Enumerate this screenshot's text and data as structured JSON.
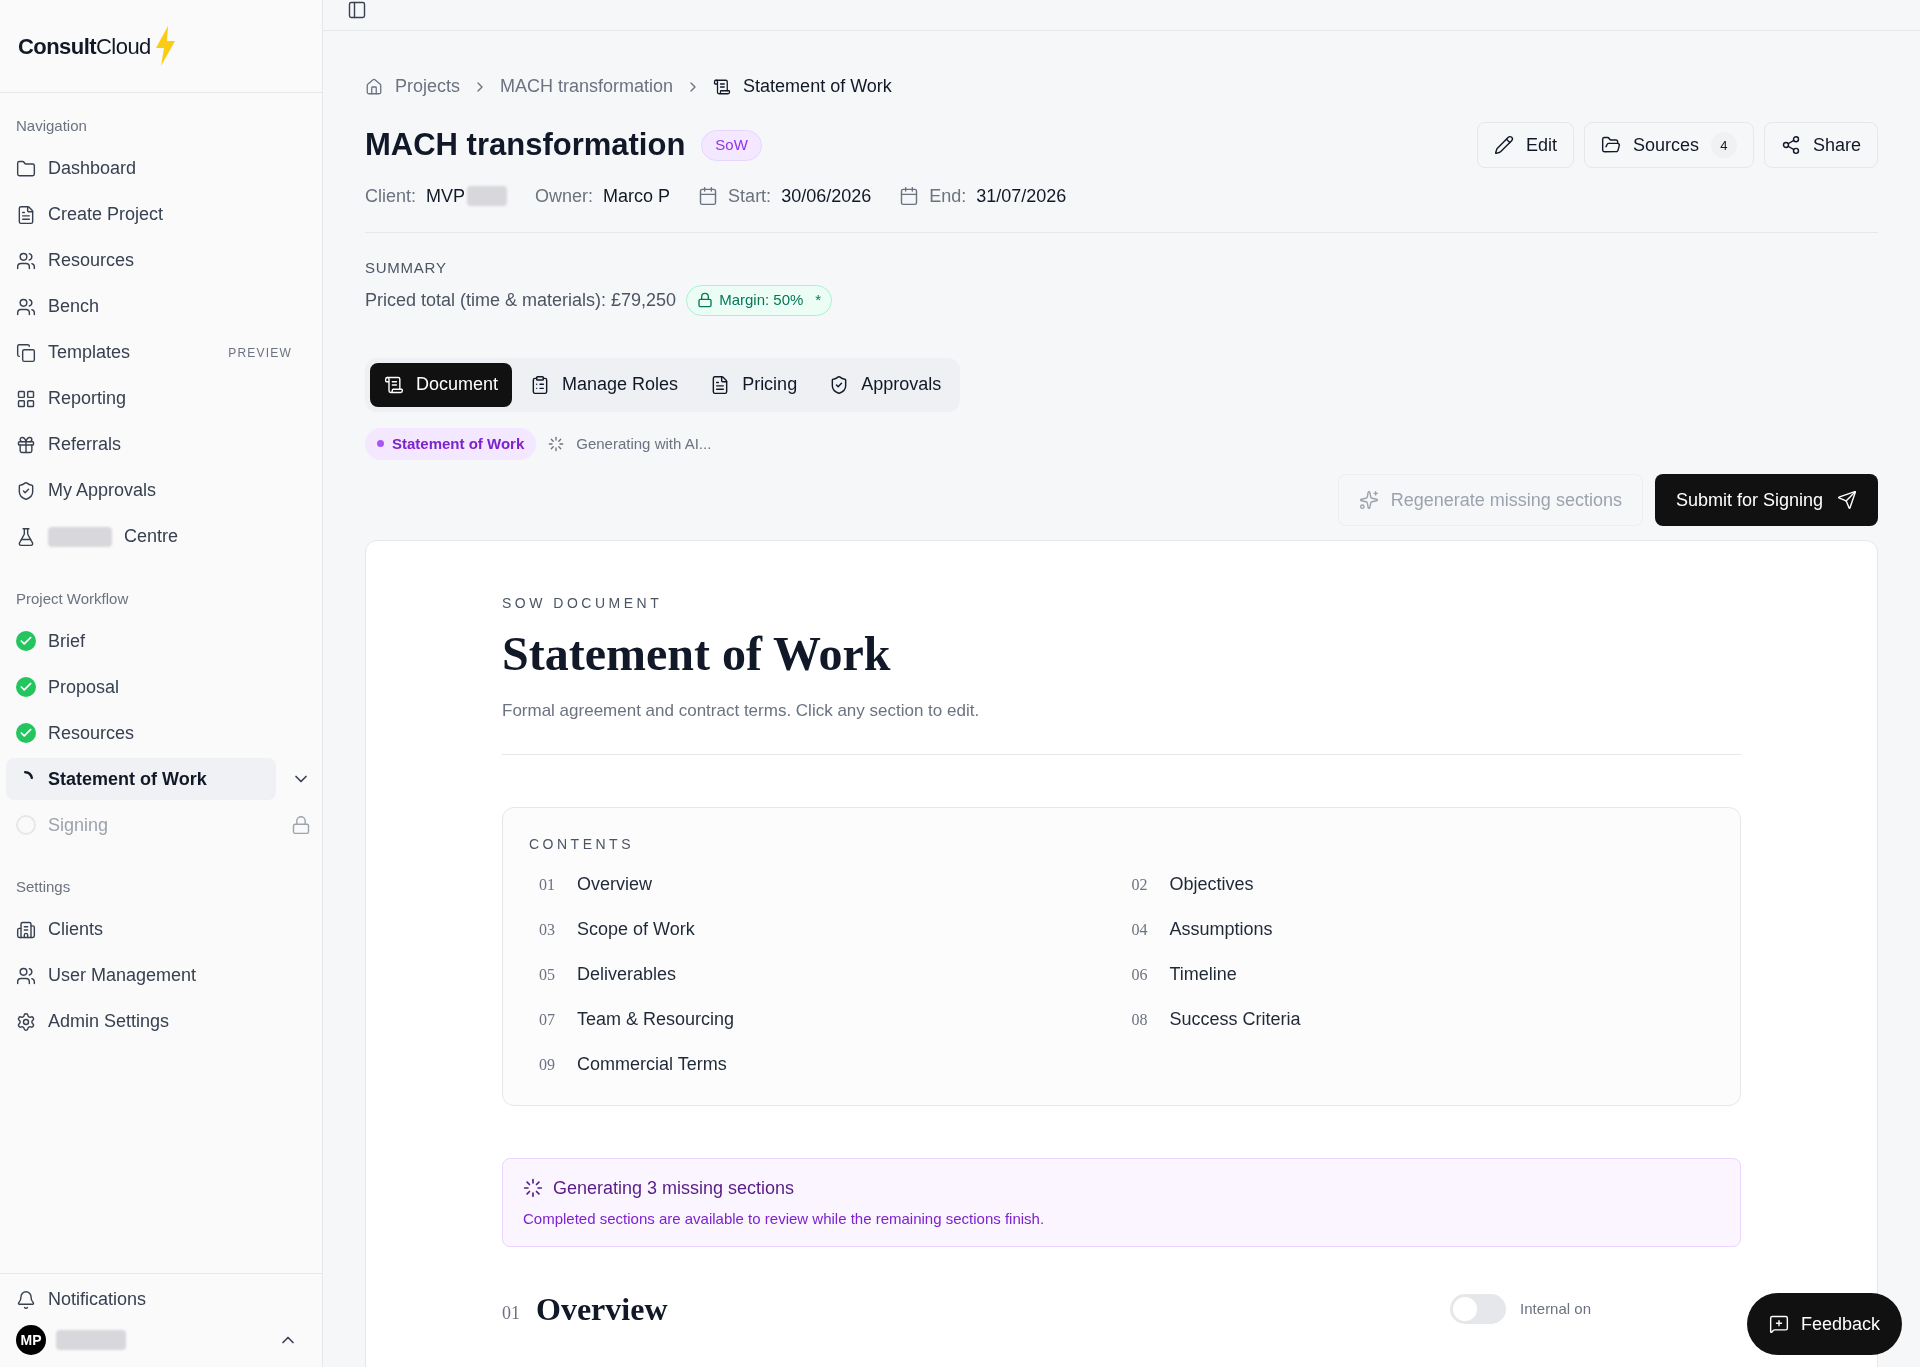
{
  "brand": {
    "name_bold": "Consult",
    "name_light": "Cloud"
  },
  "sidebar": {
    "sections": [
      {
        "heading": "Navigation",
        "items": [
          {
            "label": "Dashboard"
          },
          {
            "label": "Create Project"
          },
          {
            "label": "Resources"
          },
          {
            "label": "Bench"
          },
          {
            "label": "Templates",
            "badge": "PREVIEW"
          },
          {
            "label": "Reporting"
          },
          {
            "label": "Referrals"
          },
          {
            "label": "My Approvals"
          },
          {
            "label": "Centre",
            "redacted": true
          }
        ]
      },
      {
        "heading": "Project Workflow",
        "workflow": [
          {
            "label": "Brief",
            "kind": "done",
            "selected": false
          },
          {
            "label": "Proposal",
            "kind": "done",
            "selected": false
          },
          {
            "label": "Resources",
            "kind": "done",
            "selected": false
          },
          {
            "label": "Statement of Work",
            "kind": "progress",
            "selected": true
          },
          {
            "label": "Signing",
            "kind": "locked",
            "selected": false
          }
        ]
      },
      {
        "heading": "Settings",
        "items": [
          {
            "label": "Clients"
          },
          {
            "label": "User Management"
          },
          {
            "label": "Admin Settings"
          }
        ]
      }
    ],
    "notifications": "Notifications",
    "user": {
      "initials": "MP",
      "redacted": true
    }
  },
  "breadcrumb": [
    "Projects",
    "MACH transformation",
    "Statement of Work"
  ],
  "project": {
    "title": "MACH transformation",
    "badge": "SoW",
    "meta": [
      {
        "label": "Client:",
        "value": "MVP",
        "redacted": true,
        "kind": "text"
      },
      {
        "label": "Owner:",
        "value": "Marco P",
        "kind": "text"
      },
      {
        "label": "Start:",
        "value": "30/06/2026",
        "kind": "date"
      },
      {
        "label": "End:",
        "value": "31/07/2026",
        "kind": "date"
      }
    ],
    "actions": [
      {
        "label": "Edit"
      },
      {
        "label": "Sources",
        "count": "4"
      },
      {
        "label": "Share"
      }
    ]
  },
  "summary": {
    "heading": "SUMMARY",
    "priced": "Priced total (time & materials): £79,250",
    "margin": "Margin: 50%",
    "margin_mark": "*"
  },
  "tabs": [
    {
      "label": "Document",
      "selected": true
    },
    {
      "label": "Manage Roles",
      "selected": false
    },
    {
      "label": "Pricing",
      "selected": false
    },
    {
      "label": "Approvals",
      "selected": false
    }
  ],
  "status": {
    "chip": "Statement of Work",
    "generating": "Generating with AI..."
  },
  "buttons": {
    "regenerate": "Regenerate missing sections",
    "regenerate_disabled": true,
    "submit": "Submit for Signing"
  },
  "document": {
    "eyebrow": "SOW DOCUMENT",
    "title": "Statement of Work",
    "description": "Formal agreement and contract terms. Click any section to edit.",
    "contents_heading": "CONTENTS",
    "contents": [
      {
        "number": "01",
        "title": "Overview"
      },
      {
        "number": "02",
        "title": "Objectives"
      },
      {
        "number": "03",
        "title": "Scope of Work"
      },
      {
        "number": "04",
        "title": "Assumptions"
      },
      {
        "number": "05",
        "title": "Deliverables"
      },
      {
        "number": "06",
        "title": "Timeline"
      },
      {
        "number": "07",
        "title": "Team & Resourcing"
      },
      {
        "number": "08",
        "title": "Success Criteria"
      },
      {
        "number": "09",
        "title": "Commercial Terms"
      }
    ],
    "notice": {
      "title": "Generating 3 missing sections",
      "text": "Completed sections are available to review while the remaining sections finish."
    },
    "section": {
      "number": "01",
      "title": "Overview",
      "toggle_label": "Internal on",
      "toggle_on": false
    }
  },
  "feedback": "Feedback"
}
